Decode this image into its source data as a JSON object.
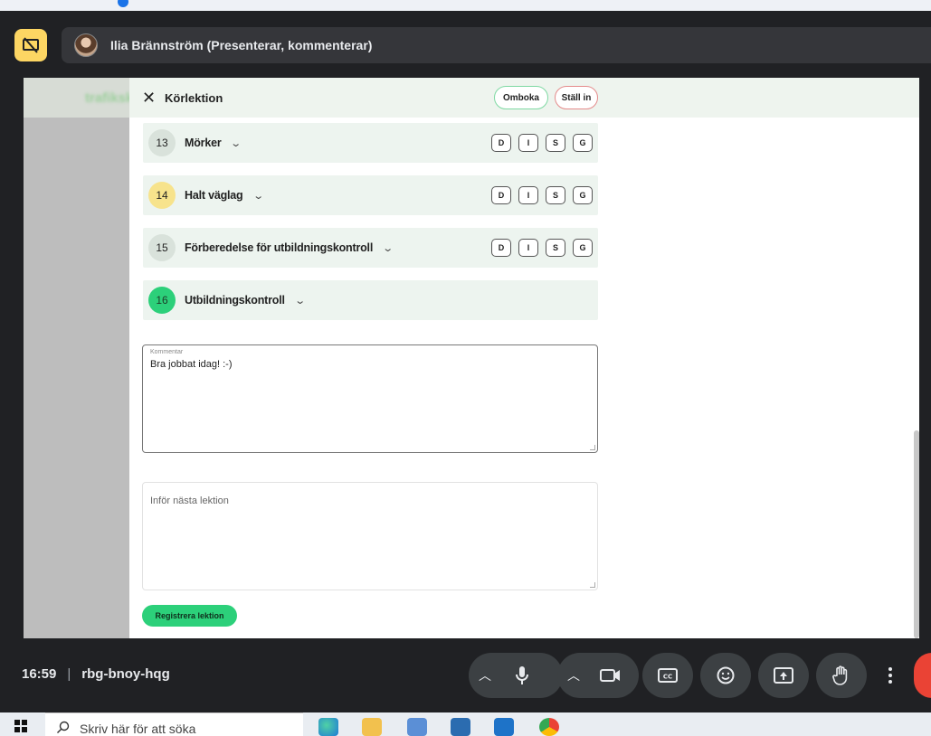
{
  "meet": {
    "presenter_name": "Ilia Brännström (Presenterar, kommenterar)",
    "time": "16:59",
    "meeting_code": "rbg-bnoy-hqg"
  },
  "dialog": {
    "brand_blurred": "trafikskola",
    "title": "Körlektion",
    "omboka_label": "Omboka",
    "stall_in_label": "Ställ in",
    "grade_labels": [
      "D",
      "I",
      "S",
      "G"
    ],
    "rows": [
      {
        "number": "13",
        "label": "Mörker",
        "status": "grey"
      },
      {
        "number": "14",
        "label": "Halt väglag",
        "status": "yellow"
      },
      {
        "number": "15",
        "label": "Förberedelse för utbildningskontroll",
        "status": "grey"
      },
      {
        "number": "16",
        "label": "Utbildningskontroll",
        "status": "green"
      }
    ],
    "comment_label": "Kommentar",
    "comment_value": "Bra jobbat idag! :-)",
    "next_lesson_placeholder": "Inför nästa lektion",
    "register_label": "Registrera lektion"
  },
  "taskbar": {
    "search_placeholder": "Skriv här för att söka",
    "icons": [
      "edge-icon",
      "file-explorer-icon",
      "notepad-icon",
      "store-icon",
      "outlook-icon",
      "chrome-icon"
    ]
  },
  "colors": {
    "accent_green": "#2cd07a",
    "presenting_yellow": "#fdd663",
    "leave_red": "#ea4335"
  }
}
